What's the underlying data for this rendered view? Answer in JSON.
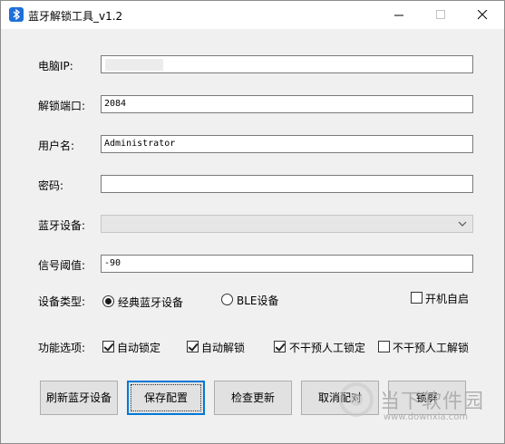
{
  "window": {
    "title": "蓝牙解锁工具_v1.2"
  },
  "fields": {
    "ip_label": "电脑IP:",
    "port_label": "解锁端口:",
    "port_value": "2084",
    "user_label": "用户名:",
    "user_value": "Administrator",
    "password_label": "密码:",
    "password_value": "",
    "device_label": "蓝牙设备:",
    "device_value": "",
    "threshold_label": "信号阈值:",
    "threshold_value": "-90"
  },
  "device_type": {
    "label": "设备类型:",
    "classic": "经典蓝牙设备",
    "classic_selected": true,
    "ble": "BLE设备",
    "ble_selected": false,
    "autostart": "开机自启",
    "autostart_checked": false
  },
  "options": {
    "label": "功能选项:",
    "items": [
      {
        "label": "自动锁定",
        "checked": true
      },
      {
        "label": "自动解锁",
        "checked": true
      },
      {
        "label": "不干预人工锁定",
        "checked": true
      },
      {
        "label": "不干预人工解锁",
        "checked": false
      }
    ]
  },
  "buttons": {
    "refresh": "刷新蓝牙设备",
    "save": "保存配置",
    "update": "检查更新",
    "unpair": "取消配对",
    "lock": "锁屏"
  },
  "watermark": {
    "text": "当下软件园",
    "url": "www.downxia.com"
  },
  "colors": {
    "accent": "#0078d7",
    "bluetooth_icon": "#1e6fd9"
  }
}
